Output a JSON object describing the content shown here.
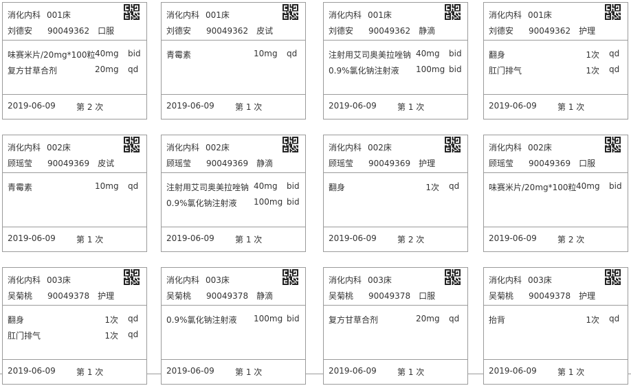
{
  "cards": [
    {
      "dept": "消化内科",
      "bed": "001床",
      "name": "刘德安",
      "pid": "90049362",
      "type": "口服",
      "drugs": [
        {
          "name": "味赛米片/20mg*100粒",
          "dose": "40mg",
          "freq": "bid"
        },
        {
          "name": "复方甘草合剂",
          "dose": "20mg",
          "freq": "qd"
        }
      ],
      "date": "2019-06-09",
      "times": "第 2 次"
    },
    {
      "dept": "消化内科",
      "bed": "001床",
      "name": "刘德安",
      "pid": "90049362",
      "type": "皮试",
      "drugs": [
        {
          "name": "青霉素",
          "dose": "10mg",
          "freq": "qd"
        }
      ],
      "date": "2019-06-09",
      "times": "第 1 次"
    },
    {
      "dept": "消化内科",
      "bed": "001床",
      "name": "刘德安",
      "pid": "90049362",
      "type": "静滴",
      "drugs": [
        {
          "name": "注射用艾司奥美拉唑钠",
          "dose": "40mg",
          "freq": "bid"
        },
        {
          "name": "0.9%氯化钠注射液",
          "dose": "100mg",
          "freq": "bid"
        }
      ],
      "date": "2019-06-09",
      "times": "第 1 次"
    },
    {
      "dept": "消化内科",
      "bed": "001床",
      "name": "刘德安",
      "pid": "90049362",
      "type": "护理",
      "drugs": [
        {
          "name": "翻身",
          "dose": "1次",
          "freq": "qd"
        },
        {
          "name": "肛门排气",
          "dose": "1次",
          "freq": "qd"
        }
      ],
      "date": "2019-06-09",
      "times": "第 1 次"
    },
    {
      "dept": "消化内科",
      "bed": "002床",
      "name": "顾瑶莹",
      "pid": "90049369",
      "type": "皮试",
      "drugs": [
        {
          "name": "青霉素",
          "dose": "10mg",
          "freq": "qd"
        }
      ],
      "date": "2019-06-09",
      "times": "第 1 次"
    },
    {
      "dept": "消化内科",
      "bed": "002床",
      "name": "顾瑶莹",
      "pid": "90049369",
      "type": "静滴",
      "drugs": [
        {
          "name": "注射用艾司奥美拉唑钠",
          "dose": "40mg",
          "freq": "bid"
        },
        {
          "name": "0.9%氯化钠注射液",
          "dose": "100mg",
          "freq": "bid"
        }
      ],
      "date": "2019-06-09",
      "times": "第 1 次"
    },
    {
      "dept": "消化内科",
      "bed": "002床",
      "name": "顾瑶莹",
      "pid": "90049369",
      "type": "护理",
      "drugs": [
        {
          "name": "翻身",
          "dose": "1次",
          "freq": "qd"
        }
      ],
      "date": "2019-06-09",
      "times": "第 2 次"
    },
    {
      "dept": "消化内科",
      "bed": "002床",
      "name": "顾瑶莹",
      "pid": "90049369",
      "type": "口服",
      "drugs": [
        {
          "name": "味赛米片/20mg*100粒",
          "dose": "40mg",
          "freq": "bid"
        }
      ],
      "date": "2019-06-09",
      "times": "第 2 次"
    },
    {
      "dept": "消化内科",
      "bed": "003床",
      "name": "吴菊桃",
      "pid": "90049378",
      "type": "护理",
      "drugs": [
        {
          "name": "翻身",
          "dose": "1次",
          "freq": "qd"
        },
        {
          "name": "肛门排气",
          "dose": "1次",
          "freq": "qd"
        }
      ],
      "date": "2019-06-09",
      "times": "第 1 次"
    },
    {
      "dept": "消化内科",
      "bed": "003床",
      "name": "吴菊桃",
      "pid": "90049378",
      "type": "静滴",
      "drugs": [
        {
          "name": "0.9%氯化钠注射液",
          "dose": "100mg",
          "freq": "bid"
        }
      ],
      "date": "2019-06-09",
      "times": "第 1 次"
    },
    {
      "dept": "消化内科",
      "bed": "003床",
      "name": "吴菊桃",
      "pid": "90049378",
      "type": "口服",
      "drugs": [
        {
          "name": "复方甘草合剂",
          "dose": "20mg",
          "freq": "qd"
        }
      ],
      "date": "2019-06-09",
      "times": "第 1 次"
    },
    {
      "dept": "消化内科",
      "bed": "003床",
      "name": "吴菊桃",
      "pid": "90049378",
      "type": "护理",
      "drugs": [
        {
          "name": "抬背",
          "dose": "1次",
          "freq": "qd"
        }
      ],
      "date": "2019-06-09",
      "times": "第 1 次"
    }
  ]
}
